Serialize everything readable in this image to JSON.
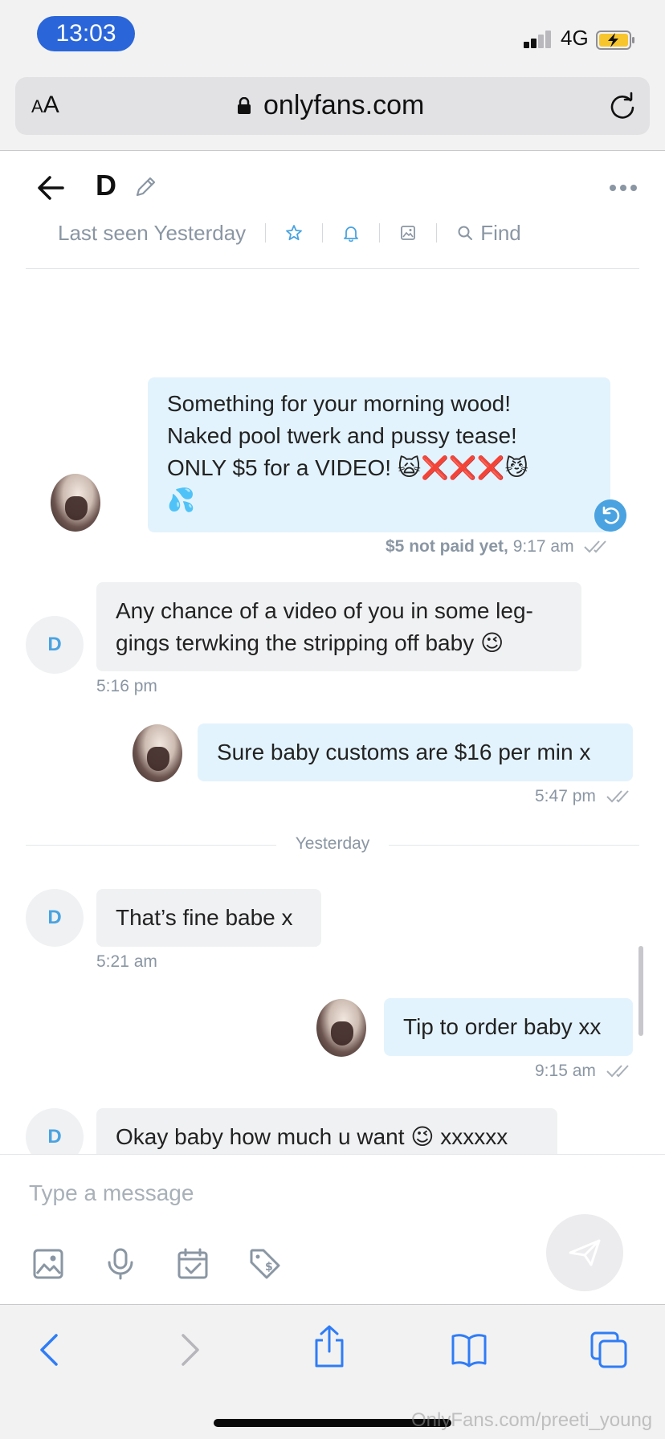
{
  "status_bar": {
    "time": "13:03",
    "network": "4G"
  },
  "browser": {
    "text_size_label_small": "A",
    "text_size_label_large": "A",
    "url": "onlyfans.com"
  },
  "chat_header": {
    "contact_name": "D",
    "last_seen": "Last seen Yesterday",
    "find_label": "Find"
  },
  "messages": [
    {
      "direction": "outgoing",
      "text_lines": [
        "Something for your morning wood!",
        "Naked pool twerk and pussy tease!",
        "ONLY $5 for a VIDEO! 🙀❌❌❌😼",
        "💦"
      ],
      "status": "$5 not paid yet,",
      "time": "9:17 am"
    },
    {
      "direction": "incoming",
      "avatar_letter": "D",
      "text_lines": [
        "Any chance of a video of you in some leg-",
        "gings terwking the stripping off baby 😉"
      ],
      "time": "5:16 pm"
    },
    {
      "direction": "outgoing",
      "text_lines": [
        "Sure baby customs are $16 per min x"
      ],
      "time": "5:47 pm"
    },
    {
      "direction": "incoming",
      "avatar_letter": "D",
      "text_lines": [
        "That’s fine babe x"
      ],
      "time": "5:21 am"
    },
    {
      "direction": "outgoing",
      "text_lines": [
        "Tip to order baby xx"
      ],
      "time": "9:15 am"
    },
    {
      "direction": "incoming",
      "avatar_letter": "D",
      "text_lines": [
        "Okay baby how much u want 😉 xxxxxx"
      ]
    }
  ],
  "day_separator": "Yesterday",
  "composer": {
    "placeholder": "Type a message"
  },
  "watermark": "OnlyFans.com/preeti_young",
  "colors": {
    "accent": "#4aa3e0",
    "outgoing_bubble": "#e3f3fd",
    "incoming_bubble": "#f0f1f3",
    "muted_text": "#8a96a3",
    "time_pill": "#2a66d9",
    "safari_blue": "#2f7cf6"
  },
  "icons": [
    "back-arrow-icon",
    "pencil-icon",
    "more-dots-icon",
    "star-icon",
    "bell-icon",
    "image-icon",
    "search-icon",
    "undo-icon",
    "double-check-icon",
    "photo-upload-icon",
    "microphone-icon",
    "calendar-check-icon",
    "price-tag-icon",
    "send-icon",
    "chevron-left-icon",
    "chevron-right-icon",
    "share-icon",
    "book-icon",
    "tabs-icon",
    "lock-icon",
    "reload-icon",
    "battery-charging-icon",
    "signal-icon"
  ]
}
